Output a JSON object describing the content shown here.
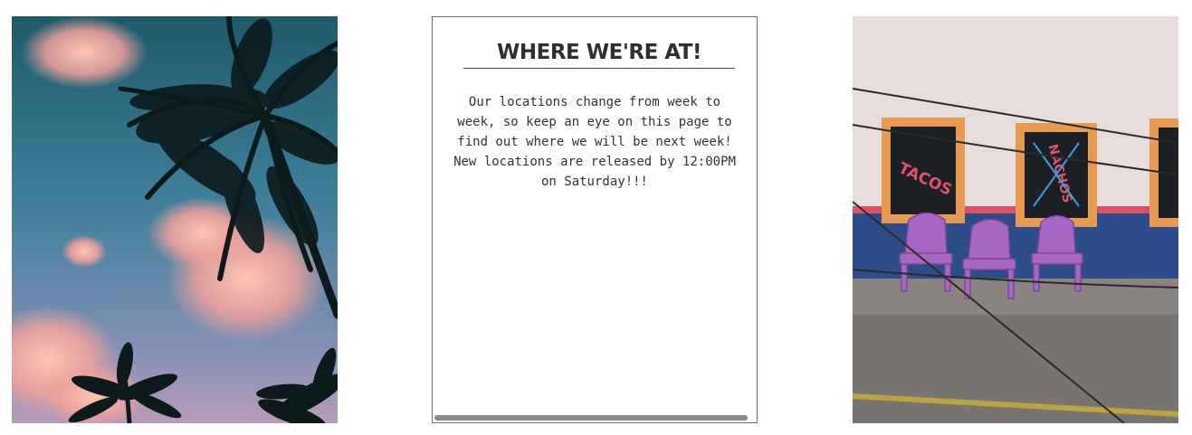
{
  "card": {
    "title": "WHERE WE'RE AT!",
    "paragraph1": "Our locations change from week to week, so keep an eye on this page to find out where we will be next week!",
    "paragraph2": "New locations are released by 12:00PM on Saturday!!!"
  },
  "right_photo": {
    "sign_left": "TACOS",
    "sign_right": "NACHOS"
  },
  "colors": {
    "card_border": "#6b6b6b",
    "title_text": "#2f2f2f",
    "body_text": "#333333",
    "scrollbar": "#8a8a8a"
  }
}
